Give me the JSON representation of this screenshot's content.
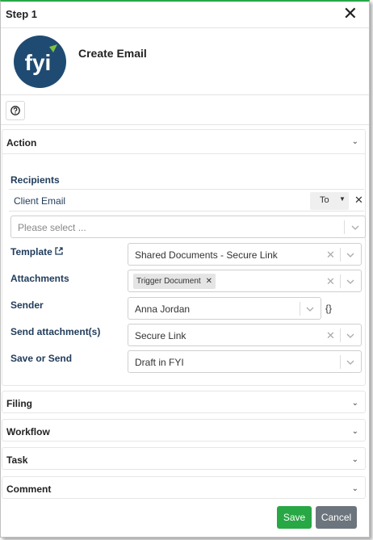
{
  "dialog": {
    "title": "Step 1"
  },
  "header": {
    "name": "Create Email",
    "logo_text": "fyi"
  },
  "sections": {
    "action": "Action",
    "filing": "Filing",
    "workflow": "Workflow",
    "task": "Task",
    "comment": "Comment"
  },
  "recipients": {
    "label": "Recipients",
    "row": {
      "name": "Client Email",
      "type": "To"
    },
    "add_placeholder": "Please select ..."
  },
  "fields": {
    "template": {
      "label": "Template",
      "value": "Shared Documents - Secure Link"
    },
    "attachments": {
      "label": "Attachments",
      "tag": "Trigger Document"
    },
    "sender": {
      "label": "Sender",
      "value": "Anna Jordan",
      "extra": "{}"
    },
    "send_attachments": {
      "label": "Send attachment(s)",
      "value": "Secure Link"
    },
    "save_or_send": {
      "label": "Save or Send",
      "value": "Draft in FYI"
    }
  },
  "buttons": {
    "save": "Save",
    "cancel": "Cancel"
  },
  "colors": {
    "accent": "#28a745",
    "logo_bg": "#1f4b73",
    "cancel": "#6c757d"
  }
}
